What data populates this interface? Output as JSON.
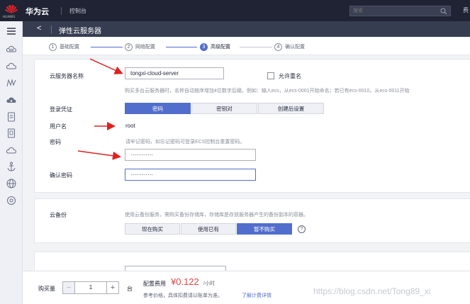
{
  "topbar": {
    "logo_text": "HUAWEI",
    "brand": "华为云",
    "console": "控制台",
    "search_placeholder": "搜索",
    "more": "费"
  },
  "sidebar": {
    "icons": [
      "menu-icon",
      "cloud-server-icon",
      "cloud-icon",
      "chart-icon",
      "storage-icon",
      "database-icon",
      "container-icon",
      "cloud-network-icon",
      "anchor-icon",
      "globe-icon",
      "settings-icon"
    ]
  },
  "header": {
    "back": "<",
    "title": "弹性云服务器"
  },
  "steps": [
    {
      "num": "1",
      "label": "基础配置",
      "state": "done"
    },
    {
      "num": "2",
      "label": "网络配置",
      "state": "done"
    },
    {
      "num": "3",
      "label": "高级配置",
      "state": "active"
    },
    {
      "num": "4",
      "label": "确认配置",
      "state": "todo"
    }
  ],
  "form": {
    "server_name_label": "云服务器名称",
    "server_name_value": "tongxi-cloud-server",
    "allow_dup_label": "允许重名",
    "server_name_hint": "购买多台云服务器时，名称自动按序增加4位数字后缀。例如：输入ecs，从ecs-0001开始命名；若已有ecs-0010，从ecs-0011开始",
    "credential_label": "登录凭证",
    "credential_tabs": [
      "密码",
      "密钥对",
      "创建后设置"
    ],
    "credential_active": 0,
    "username_label": "用户名",
    "username_value": "root",
    "password_label": "密码",
    "password_hint": "请牢记密码，如忘记密码可登录ECS控制台重置密码。",
    "password_value": "············",
    "confirm_label": "确认密码",
    "confirm_value": "············"
  },
  "backup": {
    "label": "云备份",
    "hint": "使用云备份服务，需购买备份存储库，存储库是存放服务器产生的备份副本的容器。",
    "tabs": [
      "现在购买",
      "使用已有",
      "暂不购买"
    ],
    "active": 2,
    "help": "?"
  },
  "footer": {
    "qty_label": "购买量",
    "minus": "−",
    "qty_value": "1",
    "plus": "+",
    "unit": "台",
    "fee_label": "配置费用",
    "fee_value": "¥0.122",
    "fee_unit": "/小时",
    "fee_note": "参考价格，具体扣费请以账单为准。",
    "fee_link": "了解计费详情",
    "watermark": "https://blog.csdn.net/Tong89_xi"
  },
  "colors": {
    "accent": "#526ecc",
    "topbar": "#1f2333",
    "price": "#e54545",
    "arrow": "#e02020"
  }
}
